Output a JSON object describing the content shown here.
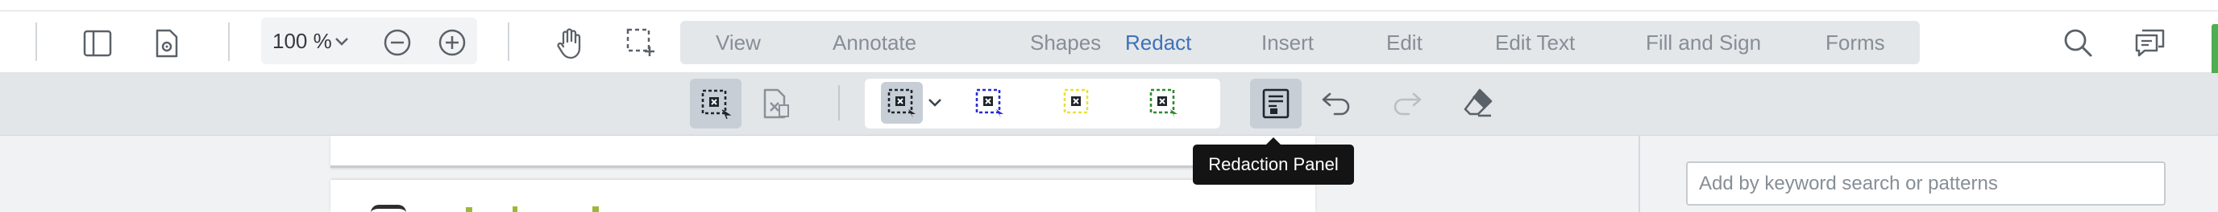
{
  "zoom": {
    "value": "100 %"
  },
  "tabs": [
    {
      "label": "View",
      "active": false
    },
    {
      "label": "Annotate",
      "active": false
    },
    {
      "label": "Shapes",
      "active": false
    },
    {
      "label": "Redact",
      "active": true
    },
    {
      "label": "Insert",
      "active": false
    },
    {
      "label": "Edit",
      "active": false
    },
    {
      "label": "Edit Text",
      "active": false
    },
    {
      "label": "Fill and Sign",
      "active": false
    },
    {
      "label": "Forms",
      "active": false
    }
  ],
  "tooltip": {
    "text": "Redaction Panel"
  },
  "panel": {
    "search_placeholder": "Add by keyword search or patterns"
  },
  "colors": {
    "active_tab": "#3d72b8",
    "redact_blue": "#2a2ad6",
    "redact_yellow": "#e8e23a",
    "redact_green": "#2f8a2f",
    "right_edge_green": "#4caf50"
  }
}
